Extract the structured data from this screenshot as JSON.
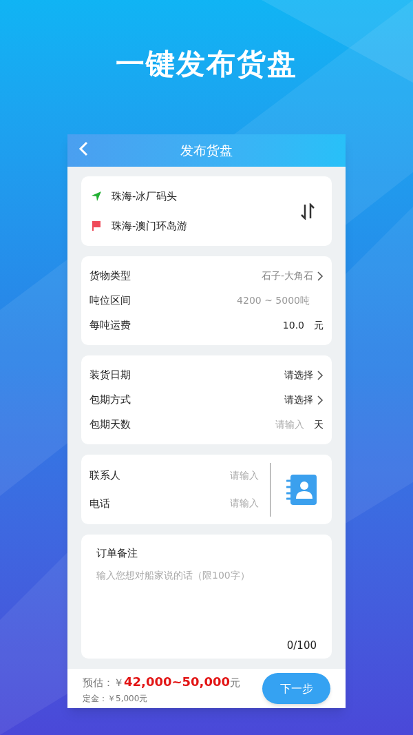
{
  "headline": "一键发布货盘",
  "header": {
    "title": "发布货盘"
  },
  "route": {
    "origin": "珠海-冰厂码头",
    "destination": "珠海-澳门环岛游"
  },
  "cargo": [
    {
      "kind": "select",
      "label": "货物类型",
      "value": "石子-大角石",
      "muted": true
    },
    {
      "kind": "text",
      "label": "吨位区间",
      "value": "4200 ~ 5000吨",
      "muted": true
    },
    {
      "kind": "unit",
      "label": "每吨运费",
      "value": "10.0",
      "unit": "元"
    }
  ],
  "schedule": [
    {
      "kind": "select",
      "label": "装货日期",
      "value": "请选择",
      "muted": false
    },
    {
      "kind": "select",
      "label": "包期方式",
      "value": "请选择",
      "muted": false
    },
    {
      "kind": "input",
      "label": "包期天数",
      "placeholder": "请输入",
      "unit": "天"
    }
  ],
  "contact": [
    {
      "label": "联系人",
      "placeholder": "请输入"
    },
    {
      "label": "电话",
      "placeholder": "请输入"
    }
  ],
  "remarks": {
    "title": "订单备注",
    "placeholder": "输入您想对船家说的话（限100字）",
    "counter": "0/100"
  },
  "footer": {
    "estimate": "预估：￥**42,000~50,000**元",
    "deposit": "定金：￥5,000元",
    "button": "下一步"
  }
}
